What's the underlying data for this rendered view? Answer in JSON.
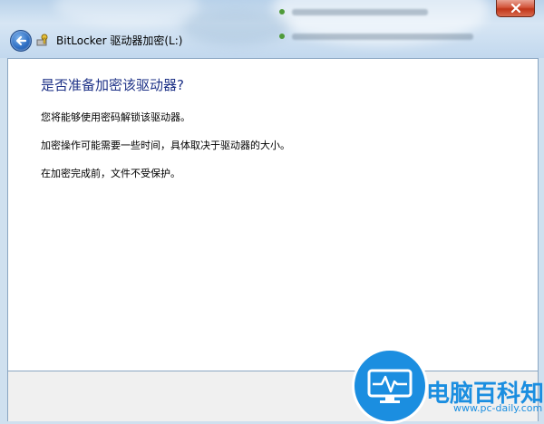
{
  "window": {
    "title": "BitLocker 驱动器加密(L:)"
  },
  "content": {
    "heading": "是否准备加密该驱动器?",
    "paragraphs": [
      "您将能够使用密码解锁该驱动器。",
      "加密操作可能需要一些时间，具体取决于驱动器的大小。",
      "在加密完成前，文件不受保护。"
    ]
  },
  "watermark": {
    "name": "电脑百科知识",
    "url": "www.pc-daily.com"
  },
  "colors": {
    "heading": "#1e3287",
    "logo": "#1b8ee0"
  },
  "icons": {
    "back": "back-arrow-icon",
    "app": "bitlocker-key-icon",
    "close": "close-icon",
    "logo": "monitor-pulse-icon"
  }
}
